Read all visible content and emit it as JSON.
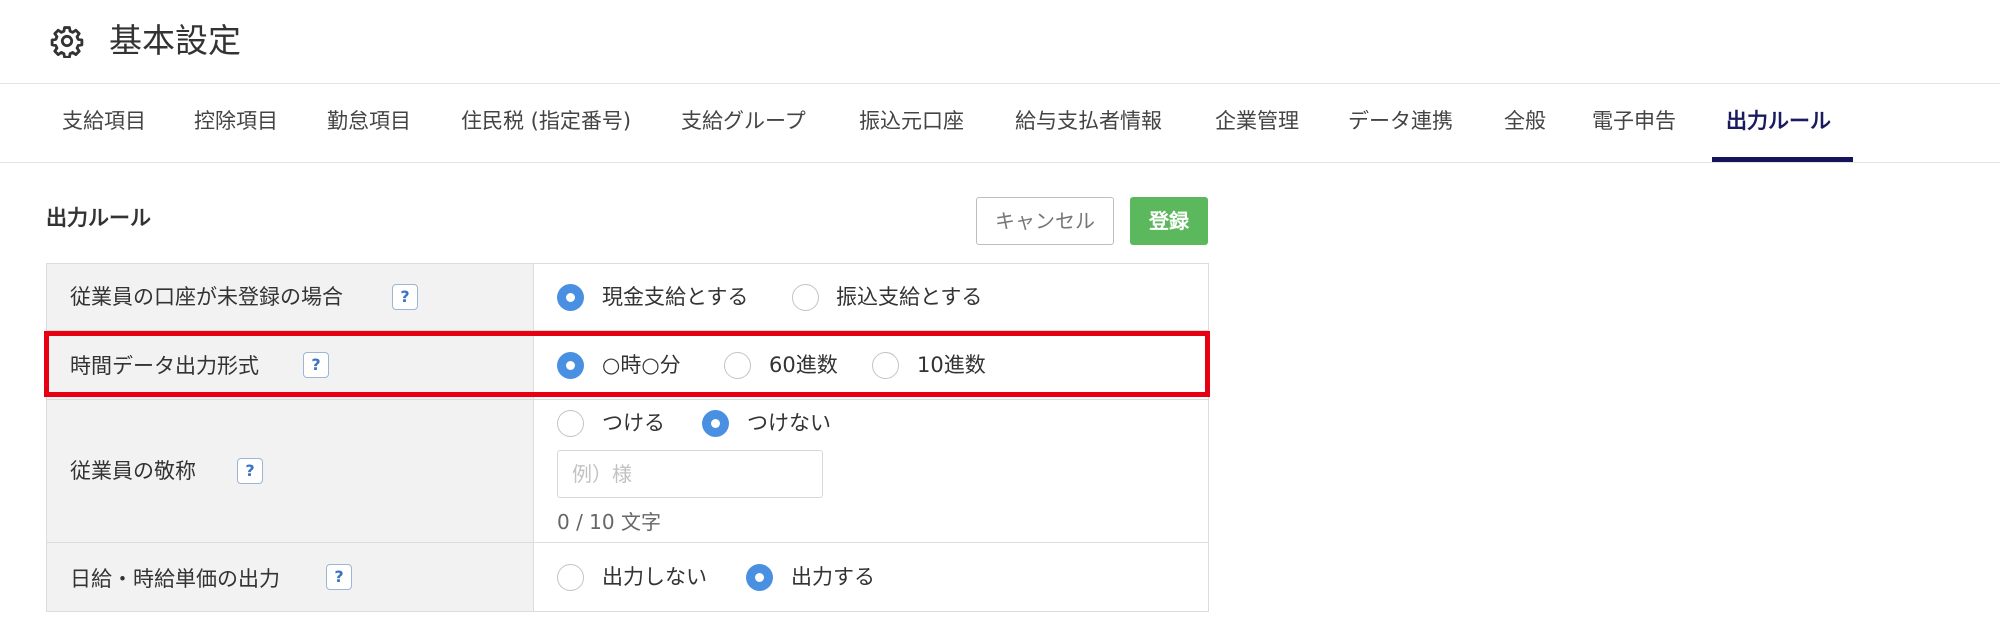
{
  "header": {
    "title": "基本設定",
    "icon": "gear-icon"
  },
  "tabs": [
    {
      "label": "支給項目"
    },
    {
      "label": "控除項目"
    },
    {
      "label": "勤怠項目"
    },
    {
      "label": "住民税 (指定番号)"
    },
    {
      "label": "支給グループ"
    },
    {
      "label": "振込元口座"
    },
    {
      "label": "給与支払者情報"
    },
    {
      "label": "企業管理"
    },
    {
      "label": "データ連携"
    },
    {
      "label": "全般"
    },
    {
      "label": "電子申告"
    },
    {
      "label": "出力ルール",
      "active": true
    }
  ],
  "section": {
    "title": "出力ルール",
    "cancel_label": "キャンセル",
    "save_label": "登録"
  },
  "rows": [
    {
      "label": "従業員の口座が未登録の場合",
      "help": "?",
      "options": [
        {
          "label": "現金支給とする",
          "checked": true
        },
        {
          "label": "振込支給とする",
          "checked": false
        }
      ]
    },
    {
      "label": "時間データ出力形式",
      "help": "?",
      "options": [
        {
          "label": "○時○分",
          "checked": true
        },
        {
          "label": "60進数",
          "checked": false
        },
        {
          "label": "10進数",
          "checked": false
        }
      ]
    },
    {
      "label": "従業員の敬称",
      "help": "?",
      "options": [
        {
          "label": "つける",
          "checked": false
        },
        {
          "label": "つけない",
          "checked": true
        }
      ],
      "input": {
        "value": "",
        "placeholder": "例）様"
      },
      "counter": "0 / 10 文字"
    },
    {
      "label": "日給・時給単価の出力",
      "help": "?",
      "options": [
        {
          "label": "出力しない",
          "checked": false
        },
        {
          "label": "出力する",
          "checked": true
        }
      ]
    }
  ],
  "colors": {
    "accent": "#4a90e2",
    "primary_button": "#5cb85c",
    "active_tab": "#14145e",
    "highlight": "#e60012"
  }
}
